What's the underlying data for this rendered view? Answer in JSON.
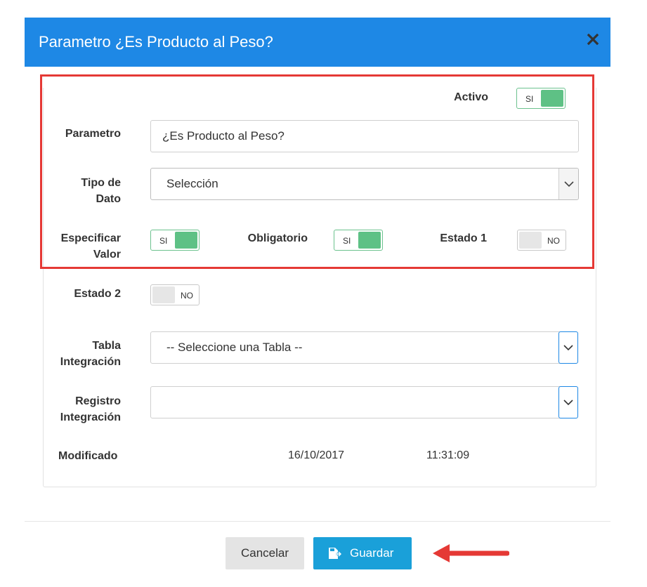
{
  "dialog": {
    "title": "Parametro ¿Es Producto al Peso?"
  },
  "form": {
    "activo": {
      "label": "Activo",
      "state": "SI"
    },
    "parametro": {
      "label": "Parametro",
      "value": "¿Es Producto al Peso?"
    },
    "tipo_dato": {
      "label_line1": "Tipo de",
      "label_line2": "Dato",
      "value": "Selección"
    },
    "especificar_valor": {
      "label_line1": "Especificar",
      "label_line2": "Valor",
      "state": "SI"
    },
    "obligatorio": {
      "label": "Obligatorio",
      "state": "SI"
    },
    "estado1": {
      "label": "Estado 1",
      "state": "NO"
    },
    "estado2": {
      "label": "Estado 2",
      "state": "NO"
    },
    "tabla_integracion": {
      "label_line1": "Tabla",
      "label_line2": "Integración",
      "value": "-- Seleccione una Tabla --"
    },
    "registro_integracion": {
      "label_line1": "Registro",
      "label_line2": "Integración",
      "value": ""
    },
    "modificado": {
      "label": "Modificado",
      "date": "16/10/2017",
      "time": "11:31:09"
    }
  },
  "footer": {
    "cancel_label": "Cancelar",
    "save_label": "Guardar"
  },
  "colors": {
    "header": "#1e88e5",
    "toggle_on": "#5ec185",
    "highlight": "#e53935",
    "save_button": "#1aa0d9"
  }
}
